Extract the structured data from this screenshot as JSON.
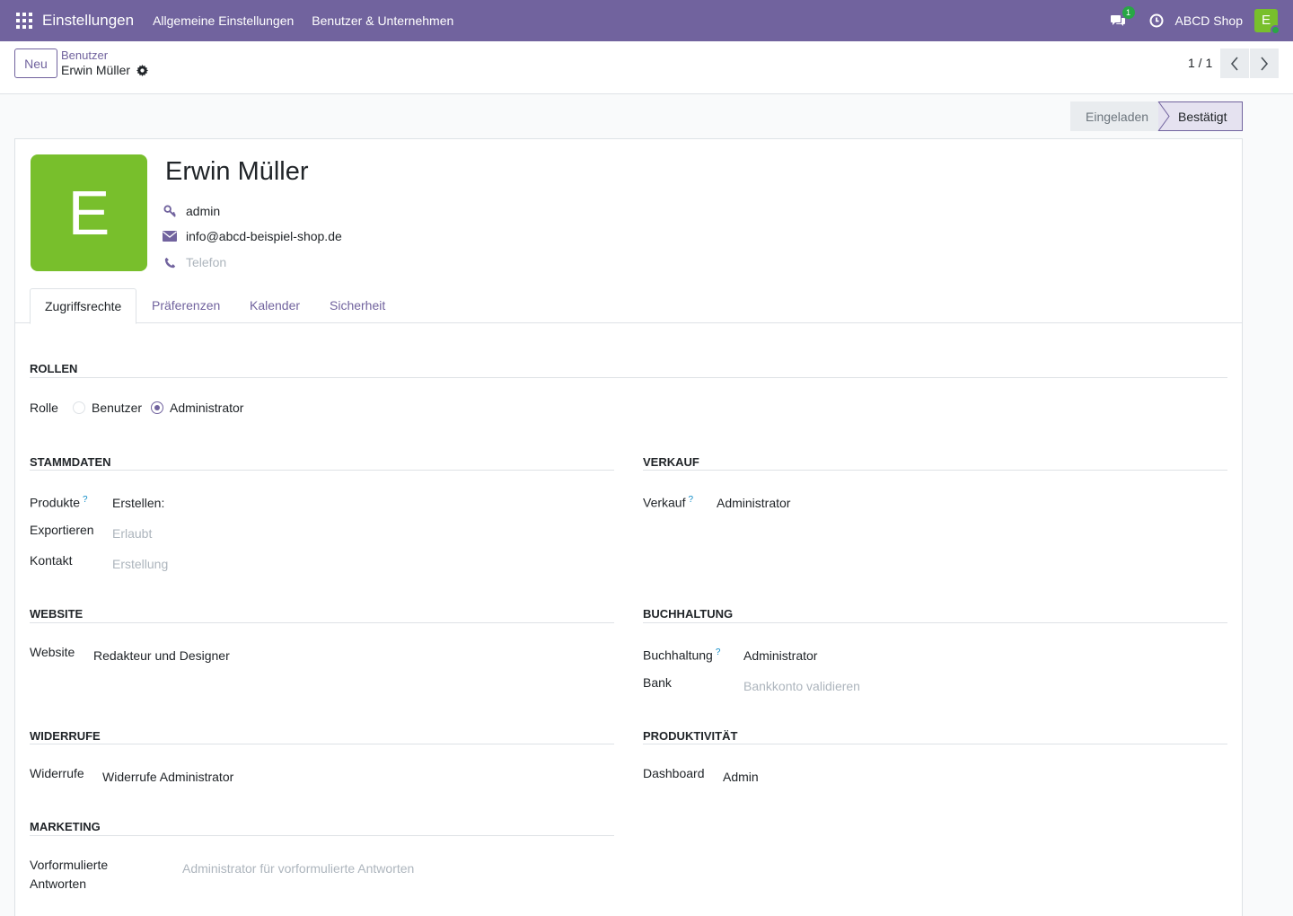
{
  "navbar": {
    "app_name": "Einstellungen",
    "menus": [
      "Allgemeine Einstellungen",
      "Benutzer & Unternehmen"
    ],
    "chat_badge": "1",
    "company": "ABCD Shop",
    "avatar_letter": "E",
    "color": "#71639e"
  },
  "control": {
    "new_button": "Neu",
    "breadcrumb_parent": "Benutzer",
    "breadcrumb_current": "Erwin Müller",
    "pager": "1 / 1"
  },
  "status": {
    "invited": "Eingeladen",
    "confirmed": "Bestätigt"
  },
  "user": {
    "avatar_letter": "E",
    "name": "Erwin Müller",
    "login": "admin",
    "email": "info@abcd-beispiel-shop.de",
    "phone_placeholder": "Telefon"
  },
  "tabs": [
    "Zugriffsrechte",
    "Präferenzen",
    "Kalender",
    "Sicherheit"
  ],
  "roles": {
    "title": "ROLLEN",
    "label": "Rolle",
    "options": [
      "Benutzer",
      "Administrator"
    ],
    "selected": "Administrator"
  },
  "stammdaten": {
    "title": "STAMMDATEN",
    "rows": [
      {
        "label": "Produkte",
        "help": "?",
        "value": "Erstellen:"
      },
      {
        "label": "Exportieren",
        "placeholder": "Erlaubt"
      },
      {
        "label": "Kontakt",
        "placeholder": "Erstellung"
      }
    ]
  },
  "verkauf": {
    "title": "VERKAUF",
    "rows": [
      {
        "label": "Verkauf",
        "help": "?",
        "value": "Administrator"
      }
    ]
  },
  "website": {
    "title": "WEBSITE",
    "rows": [
      {
        "label": "Website",
        "value": "Redakteur und Designer"
      }
    ]
  },
  "buchhaltung": {
    "title": "BUCHHALTUNG",
    "rows": [
      {
        "label": "Buchhaltung",
        "help": "?",
        "value": "Administrator"
      },
      {
        "label": "Bank",
        "placeholder": "Bankkonto validieren"
      }
    ]
  },
  "widerrufe": {
    "title": "WIDERRUFE",
    "rows": [
      {
        "label": "Widerrufe",
        "value": "Widerrufe Administrator"
      }
    ]
  },
  "produktivitaet": {
    "title": "PRODUKTIVITÄT",
    "rows": [
      {
        "label": "Dashboard",
        "value": "Admin"
      }
    ]
  },
  "marketing": {
    "title": "MARKETING",
    "rows": [
      {
        "label_line1": "Vorformulierte",
        "label_line2": "Antworten",
        "placeholder": "Administrator für vorformulierte Antworten"
      }
    ]
  }
}
